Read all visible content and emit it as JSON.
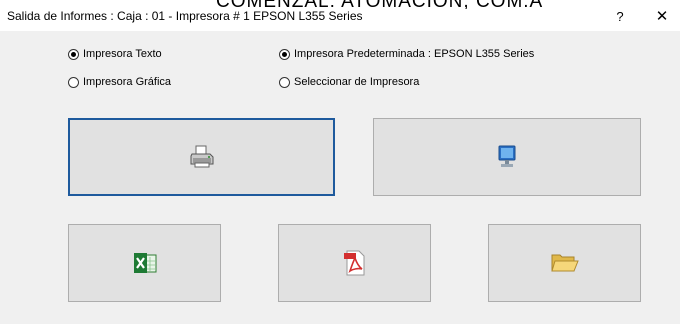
{
  "window": {
    "background_text": "COMENZAL:  ATOMACION, COM.A",
    "title": "Salida de Informes :  Caja : 01 - Impresora #  1 EPSON L355 Series",
    "help_label": "?",
    "close_label": "✕"
  },
  "options": {
    "impresora_texto": {
      "label": "Impresora Texto",
      "checked": true
    },
    "impresora_grafica": {
      "label": "Impresora Gráfica",
      "checked": false
    },
    "impresora_predeterminada": {
      "label": "Impresora Predeterminada : EPSON L355 Series",
      "checked": true
    },
    "seleccionar_impresora": {
      "label": "Seleccionar de Impresora",
      "checked": false
    }
  },
  "buttons": {
    "print": {
      "icon": "printer-icon"
    },
    "screen": {
      "icon": "monitor-icon"
    },
    "excel": {
      "icon": "excel-icon"
    },
    "pdf": {
      "icon": "pdf-icon"
    },
    "folder": {
      "icon": "folder-icon"
    }
  },
  "colors": {
    "focus_border": "#1e5a9d",
    "button_face": "#e1e1e1",
    "window_bg": "#f0f0f0"
  }
}
